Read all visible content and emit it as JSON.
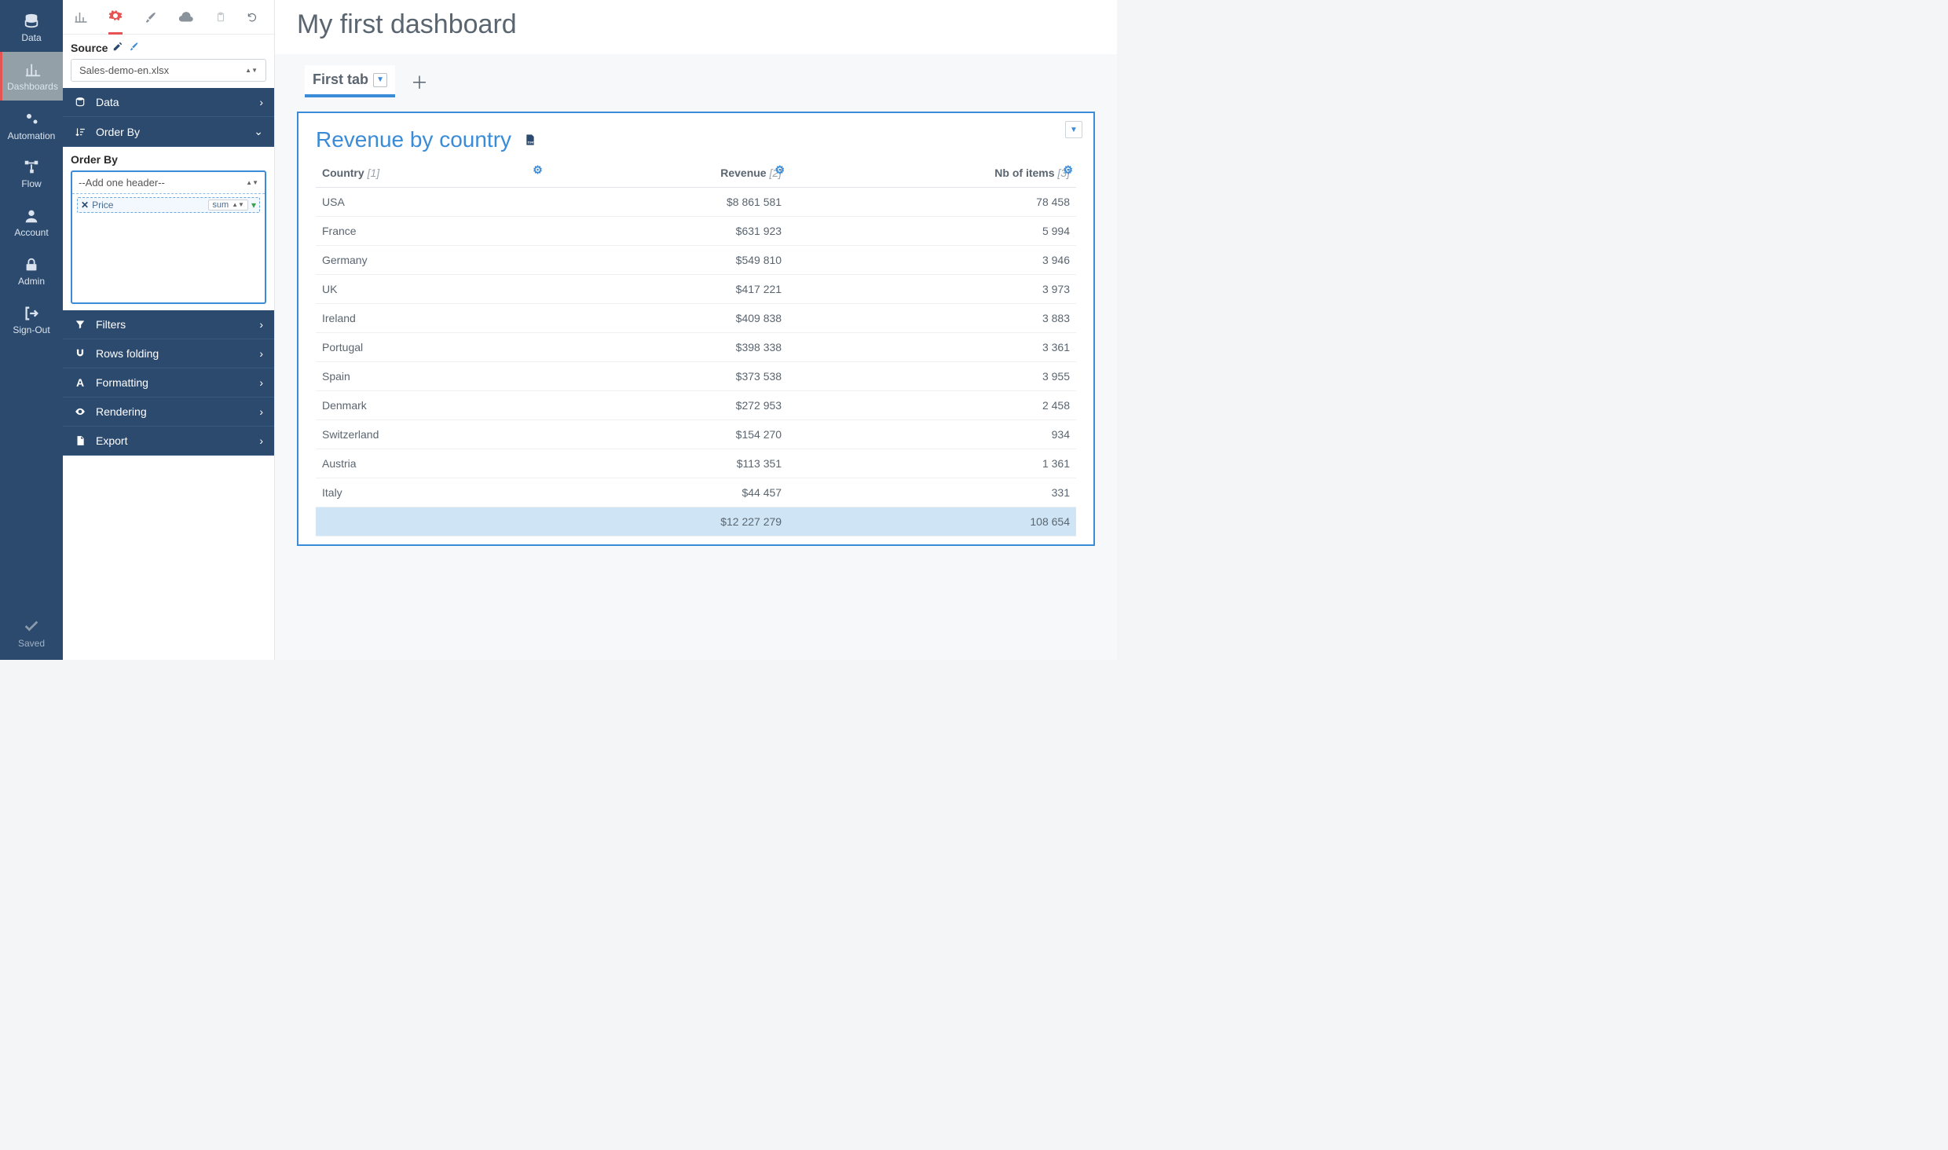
{
  "nav": {
    "items": [
      {
        "label": "Data"
      },
      {
        "label": "Dashboards"
      },
      {
        "label": "Automation"
      },
      {
        "label": "Flow"
      },
      {
        "label": "Account"
      },
      {
        "label": "Admin"
      },
      {
        "label": "Sign-Out"
      }
    ],
    "saved": "Saved"
  },
  "config": {
    "source_label": "Source",
    "source_value": "Sales-demo-en.xlsx",
    "sections": {
      "data": "Data",
      "order_by": "Order By",
      "filters": "Filters",
      "rows_folding": "Rows folding",
      "formatting": "Formatting",
      "rendering": "Rendering",
      "export": "Export"
    },
    "orderby": {
      "label": "Order By",
      "placeholder": "--Add one header--",
      "chip_label": "Price",
      "chip_agg": "sum"
    }
  },
  "dashboard": {
    "title": "My first dashboard",
    "tab": "First tab"
  },
  "widget": {
    "title": "Revenue by country",
    "columns": [
      {
        "label": "Country",
        "idx": "[1]"
      },
      {
        "label": "Revenue",
        "idx": "[2]"
      },
      {
        "label": "Nb of items",
        "idx": "[3]"
      }
    ],
    "rows": [
      {
        "country": "USA",
        "revenue": "$8 861 581",
        "items": "78 458"
      },
      {
        "country": "France",
        "revenue": "$631 923",
        "items": "5 994"
      },
      {
        "country": "Germany",
        "revenue": "$549 810",
        "items": "3 946"
      },
      {
        "country": "UK",
        "revenue": "$417 221",
        "items": "3 973"
      },
      {
        "country": "Ireland",
        "revenue": "$409 838",
        "items": "3 883"
      },
      {
        "country": "Portugal",
        "revenue": "$398 338",
        "items": "3 361"
      },
      {
        "country": "Spain",
        "revenue": "$373 538",
        "items": "3 955"
      },
      {
        "country": "Denmark",
        "revenue": "$272 953",
        "items": "2 458"
      },
      {
        "country": "Switzerland",
        "revenue": "$154 270",
        "items": "934"
      },
      {
        "country": "Austria",
        "revenue": "$113 351",
        "items": "1 361"
      },
      {
        "country": "Italy",
        "revenue": "$44 457",
        "items": "331"
      }
    ],
    "total": {
      "revenue": "$12 227 279",
      "items": "108 654"
    }
  },
  "chart_data": {
    "type": "table",
    "title": "Revenue by country",
    "columns": [
      "Country",
      "Revenue",
      "Nb of items"
    ],
    "rows": [
      [
        "USA",
        8861581,
        78458
      ],
      [
        "France",
        631923,
        5994
      ],
      [
        "Germany",
        549810,
        3946
      ],
      [
        "UK",
        417221,
        3973
      ],
      [
        "Ireland",
        409838,
        3883
      ],
      [
        "Portugal",
        398338,
        3361
      ],
      [
        "Spain",
        373538,
        3955
      ],
      [
        "Denmark",
        272953,
        2458
      ],
      [
        "Switzerland",
        154270,
        934
      ],
      [
        "Austria",
        113351,
        1361
      ],
      [
        "Italy",
        44457,
        331
      ]
    ],
    "totals": {
      "Revenue": 12227279,
      "Nb of items": 108654
    }
  }
}
